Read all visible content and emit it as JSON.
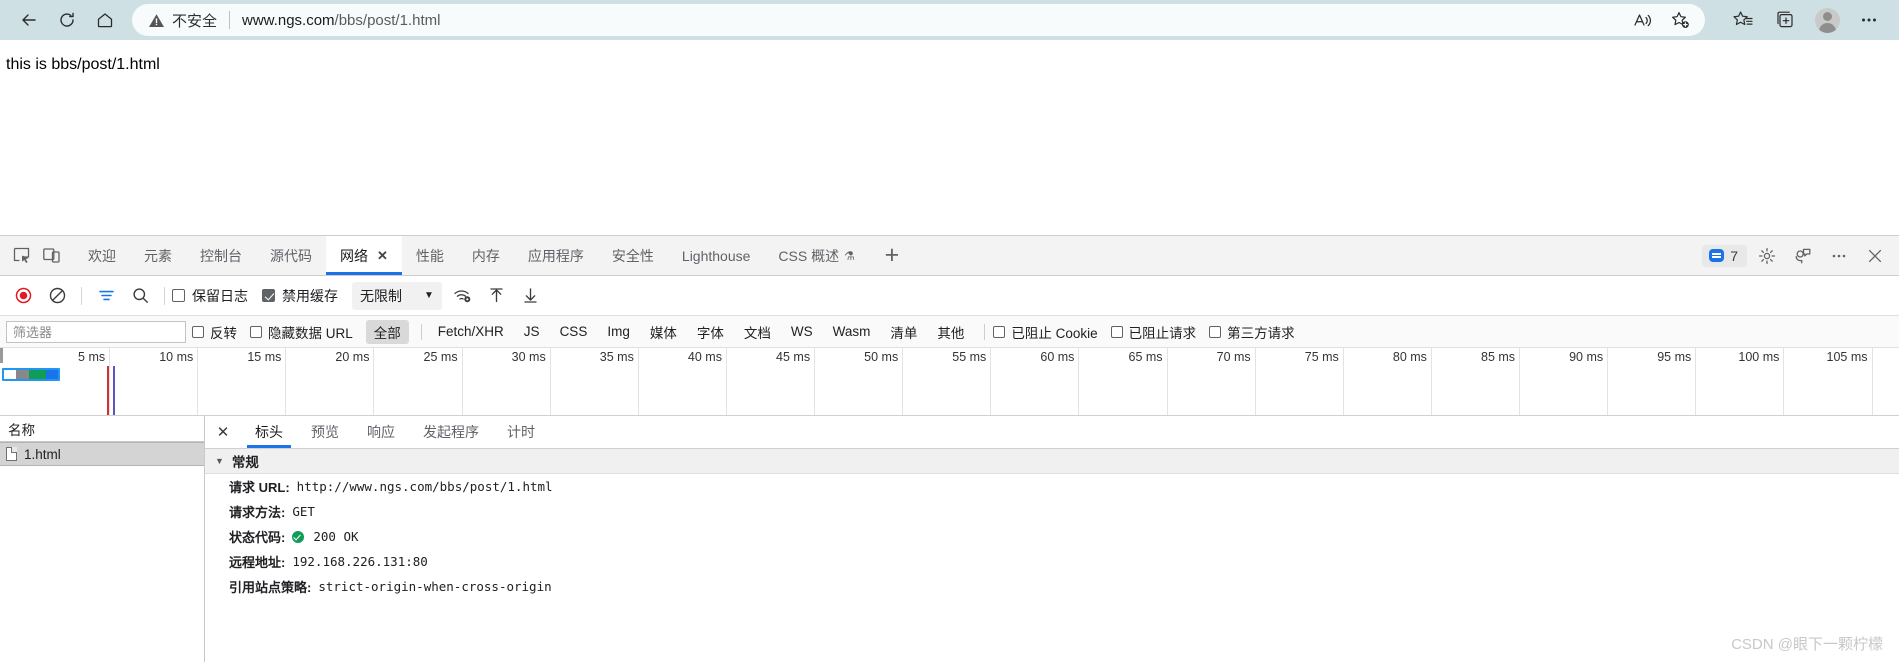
{
  "browser": {
    "back_title": "back-arrow",
    "reload_title": "reload",
    "home_title": "home",
    "security_label": "不安全",
    "url_scheme_host": "www.ngs.com",
    "url_path": "/bbs/post/1.html",
    "url_full": "www.ngs.com/bbs/post/1.html",
    "icons": {
      "read_aloud": "read-aloud-icon",
      "add_favorite": "add-favorite-icon",
      "favorites": "favorites-icon",
      "collections": "collections-icon",
      "profile": "profile-avatar",
      "settings_more": "more-options-icon"
    }
  },
  "page": {
    "body_text": "this is bbs/post/1.html"
  },
  "devtools": {
    "tabs": [
      {
        "label": "欢迎",
        "active": false
      },
      {
        "label": "元素",
        "active": false
      },
      {
        "label": "控制台",
        "active": false
      },
      {
        "label": "源代码",
        "active": false
      },
      {
        "label": "网络",
        "active": true,
        "closable": true
      },
      {
        "label": "性能",
        "active": false
      },
      {
        "label": "内存",
        "active": false
      },
      {
        "label": "应用程序",
        "active": false
      },
      {
        "label": "安全性",
        "active": false
      },
      {
        "label": "Lighthouse",
        "active": false
      },
      {
        "label": "CSS 概述",
        "active": false,
        "experimental": true
      }
    ],
    "add_tab_label": "+",
    "issues_count": "7",
    "right_icons": {
      "settings": "gear-icon",
      "feedback": "feedback-icon",
      "more": "more-options-icon",
      "close": "close-icon"
    }
  },
  "network_toolbar": {
    "record_title": "record-button",
    "clear_title": "clear-button",
    "filter_toggle_title": "filter-toggle",
    "search_title": "search-icon",
    "preserve_log_label": "保留日志",
    "preserve_log_checked": false,
    "disable_cache_label": "禁用缓存",
    "disable_cache_checked": true,
    "throttle_value": "无限制",
    "wifi_title": "network-conditions-icon",
    "import_title": "import-har-icon",
    "export_title": "export-har-icon"
  },
  "filter_row": {
    "filter_placeholder": "筛选器",
    "filter_value": "",
    "invert_label": "反转",
    "invert_checked": false,
    "hide_data_urls_label": "隐藏数据 URL",
    "hide_data_urls_checked": false,
    "types": [
      {
        "label": "全部",
        "selected": true
      },
      {
        "label": "Fetch/XHR",
        "selected": false
      },
      {
        "label": "JS",
        "selected": false
      },
      {
        "label": "CSS",
        "selected": false
      },
      {
        "label": "Img",
        "selected": false
      },
      {
        "label": "媒体",
        "selected": false
      },
      {
        "label": "字体",
        "selected": false
      },
      {
        "label": "文档",
        "selected": false
      },
      {
        "label": "WS",
        "selected": false
      },
      {
        "label": "Wasm",
        "selected": false
      },
      {
        "label": "清单",
        "selected": false
      },
      {
        "label": "其他",
        "selected": false
      }
    ],
    "blocked_cookies_label": "已阻止 Cookie",
    "blocked_cookies_checked": false,
    "blocked_requests_label": "已阻止请求",
    "blocked_requests_checked": false,
    "third_party_label": "第三方请求",
    "third_party_checked": false
  },
  "timeline": {
    "ticks": [
      "5 ms",
      "10 ms",
      "15 ms",
      "20 ms",
      "25 ms",
      "30 ms",
      "35 ms",
      "40 ms",
      "45 ms",
      "50 ms",
      "55 ms",
      "60 ms",
      "65 ms",
      "70 ms",
      "75 ms",
      "80 ms",
      "85 ms",
      "90 ms",
      "95 ms",
      "100 ms",
      "105 ms"
    ],
    "tick_step_ms": 5,
    "bar_segments": [
      "#ffffff",
      "#888888",
      "#0f9d58",
      "#1a73e8"
    ],
    "bar_border_color": "#2196f3",
    "event_lines": [
      {
        "color": "#d32f2f",
        "label": "DOMContentLoaded"
      },
      {
        "color": "#5c53c4",
        "label": "Load"
      }
    ]
  },
  "request_list": {
    "column_header": "名称",
    "rows": [
      {
        "name": "1.html",
        "selected": true,
        "icon": "document-icon"
      }
    ]
  },
  "detail_panel": {
    "close_label": "✕",
    "tabs": [
      {
        "label": "标头",
        "active": true
      },
      {
        "label": "预览",
        "active": false
      },
      {
        "label": "响应",
        "active": false
      },
      {
        "label": "发起程序",
        "active": false
      },
      {
        "label": "计时",
        "active": false
      }
    ],
    "section_title": "常规",
    "fields": [
      {
        "key": "请求 URL:",
        "value": "http://www.ngs.com/bbs/post/1.html"
      },
      {
        "key": "请求方法:",
        "value": "GET"
      },
      {
        "key": "状态代码:",
        "value": "200 OK",
        "status_ok": true
      },
      {
        "key": "远程地址:",
        "value": "192.168.226.131:80"
      },
      {
        "key": "引用站点策略:",
        "value": "strict-origin-when-cross-origin"
      }
    ]
  },
  "watermark": "CSDN @眼下一颗柠檬"
}
